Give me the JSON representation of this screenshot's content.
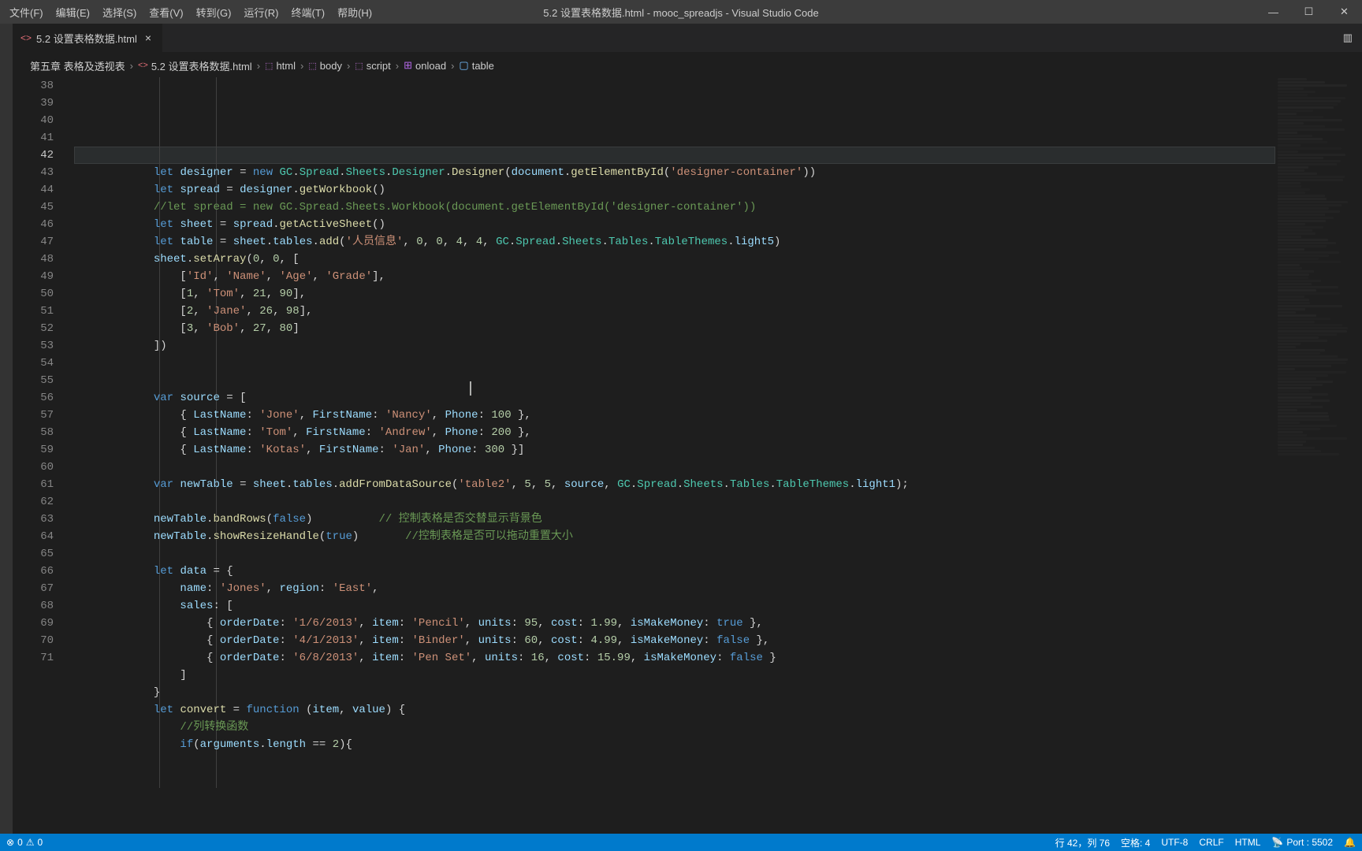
{
  "menubar": {
    "items": [
      "文件(F)",
      "编辑(E)",
      "选择(S)",
      "查看(V)",
      "转到(G)",
      "运行(R)",
      "终端(T)",
      "帮助(H)"
    ]
  },
  "title": "5.2 设置表格数据.html - mooc_spreadjs - Visual Studio Code",
  "tab": {
    "icon": "<>",
    "name": "5.2 设置表格数据.html",
    "close": "×"
  },
  "layout_icon": "▥",
  "breadcrumbs": {
    "parts": [
      "第五章 表格及透视表",
      "5.2 设置表格数据.html",
      "html",
      "body",
      "script",
      "onload",
      "table"
    ]
  },
  "win": {
    "min": "—",
    "max": "☐",
    "close": "✕"
  },
  "lines": {
    "start": 38,
    "current": 42,
    "items": [
      {
        "n": 38,
        "h": "            <span class='k'>let</span> <span class='v'>designer</span> = <span class='k'>new</span> <span class='t'>GC</span>.<span class='t'>Spread</span>.<span class='t'>Sheets</span>.<span class='t'>Designer</span>.<span class='fn'>Designer</span>(<span class='v'>document</span>.<span class='fn'>getElementById</span>(<span class='s'>'designer-container'</span>))"
      },
      {
        "n": 39,
        "h": "            <span class='k'>let</span> <span class='v'>spread</span> = <span class='v'>designer</span>.<span class='fn'>getWorkbook</span>()"
      },
      {
        "n": 40,
        "h": "            <span class='c'>//let spread = new GC.Spread.Sheets.Workbook(document.getElementById('designer-container'))</span>"
      },
      {
        "n": 41,
        "h": "            <span class='k'>let</span> <span class='v'>sheet</span> = <span class='v'>spread</span>.<span class='fn'>getActiveSheet</span>()"
      },
      {
        "n": 42,
        "h": "            <span class='k'>let</span> <span class='v'>table</span> = <span class='v'>sheet</span>.<span class='v'>tables</span>.<span class='fn'>add</span>(<span class='s'>'人员信息'</span>, <span class='n'>0</span>, <span class='n'>0</span>, <span class='n'>4</span>, <span class='n'>4</span>, <span class='t'>GC</span>.<span class='t'>Spread</span>.<span class='t'>Sheets</span>.<span class='t'>Tables</span>.<span class='t'>TableThemes</span>.<span class='v'>light5</span>)"
      },
      {
        "n": 43,
        "h": "            <span class='v'>sheet</span>.<span class='fn'>setArray</span>(<span class='n'>0</span>, <span class='n'>0</span>, ["
      },
      {
        "n": 44,
        "h": "                [<span class='s'>'Id'</span>, <span class='s'>'Name'</span>, <span class='s'>'Age'</span>, <span class='s'>'Grade'</span>],"
      },
      {
        "n": 45,
        "h": "                [<span class='n'>1</span>, <span class='s'>'Tom'</span>, <span class='n'>21</span>, <span class='n'>90</span>],"
      },
      {
        "n": 46,
        "h": "                [<span class='n'>2</span>, <span class='s'>'Jane'</span>, <span class='n'>26</span>, <span class='n'>98</span>],"
      },
      {
        "n": 47,
        "h": "                [<span class='n'>3</span>, <span class='s'>'Bob'</span>, <span class='n'>27</span>, <span class='n'>80</span>]"
      },
      {
        "n": 48,
        "h": "            ])"
      },
      {
        "n": 49,
        "h": ""
      },
      {
        "n": 50,
        "h": ""
      },
      {
        "n": 51,
        "h": "            <span class='k'>var</span> <span class='v'>source</span> = ["
      },
      {
        "n": 52,
        "h": "                { <span class='v'>LastName</span>: <span class='s'>'Jone'</span>, <span class='v'>FirstName</span>: <span class='s'>'Nancy'</span>, <span class='v'>Phone</span>: <span class='n'>100</span> },"
      },
      {
        "n": 53,
        "h": "                { <span class='v'>LastName</span>: <span class='s'>'Tom'</span>, <span class='v'>FirstName</span>: <span class='s'>'Andrew'</span>, <span class='v'>Phone</span>: <span class='n'>200</span> },"
      },
      {
        "n": 54,
        "h": "                { <span class='v'>LastName</span>: <span class='s'>'Kotas'</span>, <span class='v'>FirstName</span>: <span class='s'>'Jan'</span>, <span class='v'>Phone</span>: <span class='n'>300</span> }]"
      },
      {
        "n": 55,
        "h": ""
      },
      {
        "n": 56,
        "h": "            <span class='k'>var</span> <span class='v'>newTable</span> = <span class='v'>sheet</span>.<span class='v'>tables</span>.<span class='fn'>addFromDataSource</span>(<span class='s'>'table2'</span>, <span class='n'>5</span>, <span class='n'>5</span>, <span class='v'>source</span>, <span class='t'>GC</span>.<span class='t'>Spread</span>.<span class='t'>Sheets</span>.<span class='t'>Tables</span>.<span class='t'>TableThemes</span>.<span class='v'>light1</span>);"
      },
      {
        "n": 57,
        "h": ""
      },
      {
        "n": 58,
        "h": "            <span class='v'>newTable</span>.<span class='fn'>bandRows</span>(<span class='k'>false</span>)          <span class='c'>// 控制表格是否交替显示背景色</span>"
      },
      {
        "n": 59,
        "h": "            <span class='v'>newTable</span>.<span class='fn'>showResizeHandle</span>(<span class='k'>true</span>)       <span class='c'>//控制表格是否可以拖动重置大小</span>"
      },
      {
        "n": 60,
        "h": ""
      },
      {
        "n": 61,
        "h": "            <span class='k'>let</span> <span class='v'>data</span> = {"
      },
      {
        "n": 62,
        "h": "                <span class='v'>name</span>: <span class='s'>'Jones'</span>, <span class='v'>region</span>: <span class='s'>'East'</span>,"
      },
      {
        "n": 63,
        "h": "                <span class='v'>sales</span>: ["
      },
      {
        "n": 64,
        "h": "                    { <span class='v'>orderDate</span>: <span class='s'>'1/6/2013'</span>, <span class='v'>item</span>: <span class='s'>'Pencil'</span>, <span class='v'>units</span>: <span class='n'>95</span>, <span class='v'>cost</span>: <span class='n'>1.99</span>, <span class='v'>isMakeMoney</span>: <span class='k'>true</span> },"
      },
      {
        "n": 65,
        "h": "                    { <span class='v'>orderDate</span>: <span class='s'>'4/1/2013'</span>, <span class='v'>item</span>: <span class='s'>'Binder'</span>, <span class='v'>units</span>: <span class='n'>60</span>, <span class='v'>cost</span>: <span class='n'>4.99</span>, <span class='v'>isMakeMoney</span>: <span class='k'>false</span> },"
      },
      {
        "n": 66,
        "h": "                    { <span class='v'>orderDate</span>: <span class='s'>'6/8/2013'</span>, <span class='v'>item</span>: <span class='s'>'Pen Set'</span>, <span class='v'>units</span>: <span class='n'>16</span>, <span class='v'>cost</span>: <span class='n'>15.99</span>, <span class='v'>isMakeMoney</span>: <span class='k'>false</span> }"
      },
      {
        "n": 67,
        "h": "                ]"
      },
      {
        "n": 68,
        "h": "            }"
      },
      {
        "n": 69,
        "h": "            <span class='k'>let</span> <span class='fn'>convert</span> = <span class='k'>function</span> (<span class='v'>item</span>, <span class='v'>value</span>) {"
      },
      {
        "n": 70,
        "h": "                <span class='c'>//列转换函数</span>"
      },
      {
        "n": 71,
        "h": "                <span class='k'>if</span>(<span class='v'>arguments</span>.<span class='v'>length</span> == <span class='n'>2</span>){"
      }
    ]
  },
  "status": {
    "err_icon": "⊗",
    "err": "0",
    "warn_icon": "⚠",
    "warn": "0",
    "line_col": "行 42，列 76",
    "spaces": "空格: 4",
    "encoding": "UTF-8",
    "eol": "CRLF",
    "lang": "HTML",
    "port_icon": "📡",
    "port": "Port : 5502",
    "bell": "🔔"
  }
}
